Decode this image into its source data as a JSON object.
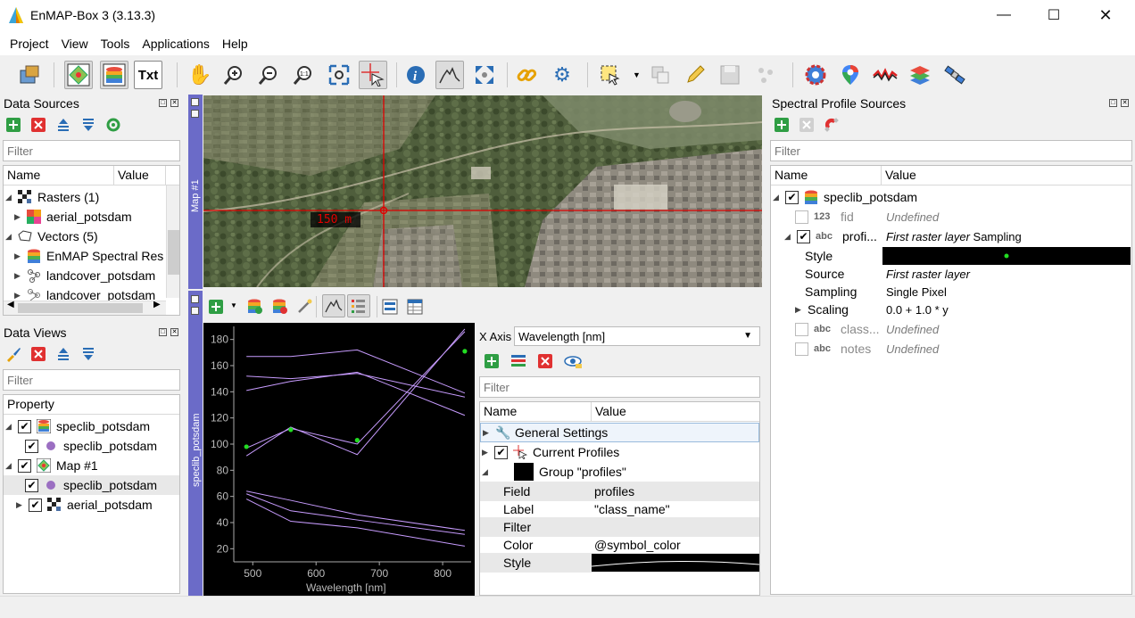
{
  "window": {
    "title": "EnMAP-Box 3 (3.13.3)"
  },
  "menu": [
    "Project",
    "View",
    "Tools",
    "Applications",
    "Help"
  ],
  "toolbar": {
    "txt_label": "Txt"
  },
  "data_sources": {
    "title": "Data Sources",
    "filter_placeholder": "Filter",
    "col_name": "Name",
    "col_value": "Value",
    "rows": [
      "Rasters (1)",
      "aerial_potsdam",
      "Vectors (5)",
      "EnMAP Spectral Res",
      "landcover_potsdam",
      "landcover_potsdam"
    ]
  },
  "data_views": {
    "title": "Data Views",
    "filter_placeholder": "Filter",
    "col_property": "Property",
    "rows": [
      "speclib_potsdam",
      "speclib_potsdam",
      "Map #1",
      "speclib_potsdam",
      "aerial_potsdam"
    ]
  },
  "map": {
    "tab_label": "Map #1",
    "scale_label": "150 m"
  },
  "spectral": {
    "tab_label": "speclib_potsdam",
    "xaxis_label": "X Axis",
    "xaxis_value": "Wavelength [nm]",
    "filter_placeholder": "Filter",
    "col_name": "Name",
    "col_value": "Value",
    "general_settings": "General Settings",
    "current_profiles": "Current Profiles",
    "group": "Group \"profiles\"",
    "props": [
      {
        "name": "Field",
        "value": "profiles"
      },
      {
        "name": "Label",
        "value": "\"class_name\""
      },
      {
        "name": "Filter",
        "value": ""
      },
      {
        "name": "Color",
        "value": "@symbol_color"
      },
      {
        "name": "Style",
        "value": ""
      }
    ]
  },
  "chart_data": {
    "type": "line",
    "title": "",
    "xlabel": "Wavelength [nm]",
    "ylabel": "",
    "xlim": [
      470,
      845
    ],
    "ylim": [
      10,
      190
    ],
    "xticks": [
      500,
      600,
      700,
      800
    ],
    "yticks": [
      20,
      40,
      60,
      80,
      100,
      120,
      140,
      160,
      180
    ],
    "x": [
      490,
      560,
      665,
      835
    ],
    "series": [
      {
        "values": [
          97,
          112,
          100,
          186
        ]
      },
      {
        "values": [
          91,
          113,
          92,
          188
        ]
      },
      {
        "values": [
          167,
          167,
          172,
          139
        ]
      },
      {
        "values": [
          152,
          150,
          154,
          136
        ]
      },
      {
        "values": [
          141,
          148,
          155,
          122
        ]
      },
      {
        "values": [
          64,
          57,
          46,
          34
        ]
      },
      {
        "values": [
          62,
          49,
          42,
          31
        ]
      },
      {
        "values": [
          58,
          41,
          36,
          22
        ]
      }
    ],
    "current_profile_points": [
      {
        "x": 490,
        "y": 98
      },
      {
        "x": 560,
        "y": 111
      },
      {
        "x": 665,
        "y": 103
      },
      {
        "x": 835,
        "y": 171
      }
    ],
    "line_color": "#c89cff",
    "point_color": "#22dd22",
    "background": "#000000"
  },
  "profile_sources": {
    "title": "Spectral Profile Sources",
    "filter_placeholder": "Filter",
    "col_name": "Name",
    "col_value": "Value",
    "rows": [
      {
        "name": "speclib_potsdam",
        "value": ""
      },
      {
        "type": "123",
        "name": "fid",
        "value": "Undefined"
      },
      {
        "type": "abc",
        "name": "profi...",
        "value_italic": "First raster layer",
        "value_plain": " Sampling"
      },
      {
        "name": "Style",
        "value": ""
      },
      {
        "name": "Source",
        "value": "First raster layer"
      },
      {
        "name": "Sampling",
        "value": "Single Pixel"
      },
      {
        "name": "Scaling",
        "value": "0.0 + 1.0 * y"
      },
      {
        "type": "abc",
        "name": "class...",
        "value": "Undefined"
      },
      {
        "type": "abc",
        "name": "notes",
        "value": "Undefined"
      }
    ]
  }
}
